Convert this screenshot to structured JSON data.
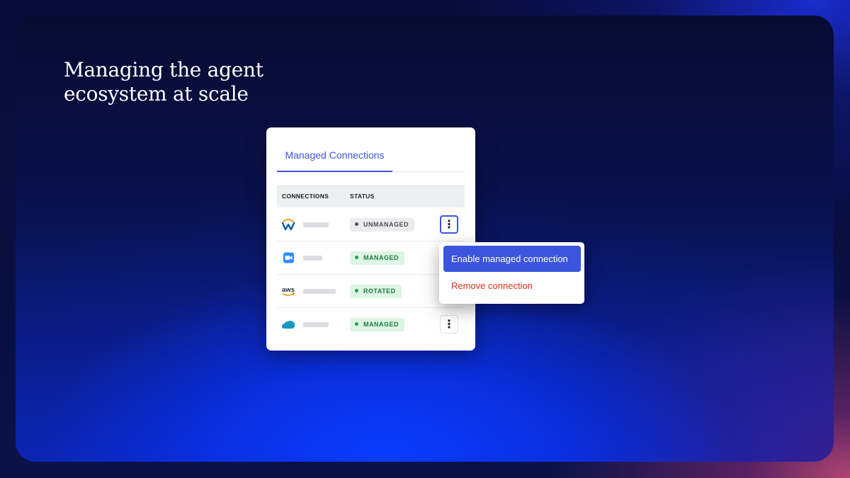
{
  "headline": {
    "line1": "Managing the agent",
    "line2": "ecosystem at scale"
  },
  "card": {
    "tab_label": "Managed Connections",
    "columns": {
      "connections": "CONNECTIONS",
      "status": "STATUS"
    },
    "rows": [
      {
        "logo": "workday-icon",
        "status": "UNMANAGED",
        "status_color": "#505158"
      },
      {
        "logo": "zoom-icon",
        "status": "MANAGED",
        "status_color": "#1b7f3c"
      },
      {
        "logo": "aws-icon",
        "logo_text": "aws",
        "status": "ROTATED",
        "status_color": "#1b7f3c"
      },
      {
        "logo": "salesforce-icon",
        "status": "MANAGED",
        "status_color": "#1b7f3c"
      }
    ]
  },
  "menu": {
    "enable_label": "Enable managed connection",
    "remove_label": "Remove connection"
  },
  "colors": {
    "accent": "#3c55dc",
    "danger": "#d4321a",
    "success": "#1b7f3c"
  }
}
